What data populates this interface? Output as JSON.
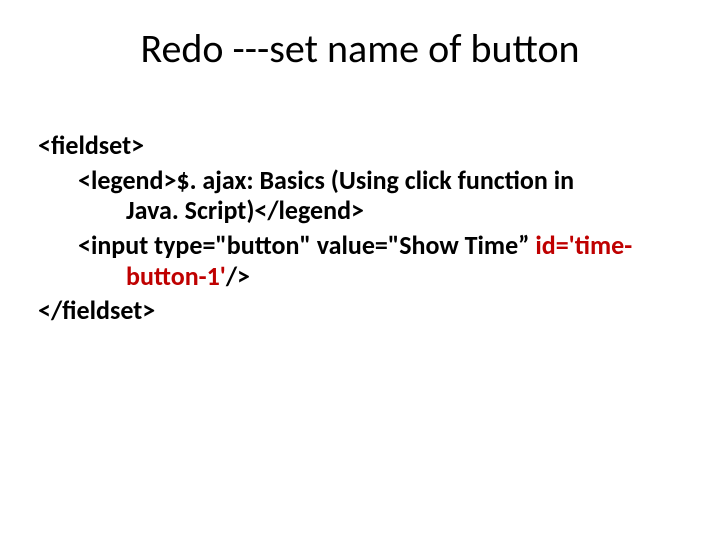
{
  "title": "Redo ---set name of button",
  "lines": {
    "l0": "<fieldset>",
    "l1a": "<legend>$. ajax: Basics (Using click function in",
    "l1b": "Java. Script)</legend>",
    "l2a_pre": "<input type=\"button\" value=\"Show Time” ",
    "l2a_hi": "id='time-",
    "l2b_hi": "button-1'",
    "l2b_post": "/>",
    "l3": "</fieldset>"
  }
}
